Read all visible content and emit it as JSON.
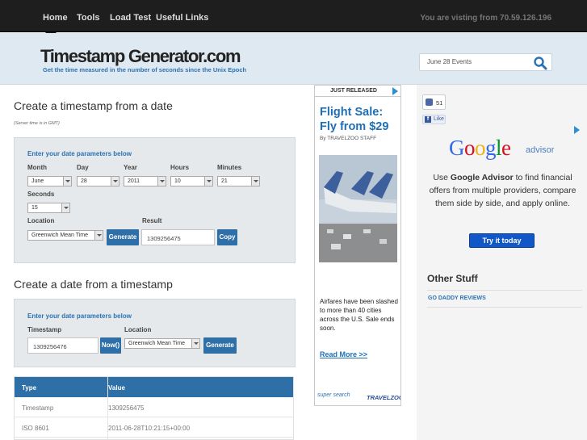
{
  "nav": {
    "items": [
      {
        "label": "Home"
      },
      {
        "label": "Tools"
      },
      {
        "label": "Load Test"
      },
      {
        "label": "Useful Links"
      }
    ],
    "visitor_text": "You are visting from 70.59.126.196"
  },
  "header": {
    "logo": "Timestamp Generator.com",
    "tagline": "Get the time measured in the number of seconds since the Unix Epoch",
    "search_value": "June 28 Events",
    "search_icon": "magnifier-icon"
  },
  "date_to_ts": {
    "title": "Create a timestamp from a date",
    "note": "(Server time is in GMT)",
    "panel_title": "Enter your date parameters below",
    "labels": {
      "month": "Month",
      "day": "Day",
      "year": "Year",
      "hours": "Hours",
      "minutes": "Minutes",
      "seconds": "Seconds",
      "location": "Location",
      "result": "Result"
    },
    "values": {
      "month": "June",
      "day": "28",
      "year": "2011",
      "hours": "10",
      "minutes": "21",
      "seconds": "15",
      "location": "Greenwich Mean Time",
      "result": "1309256475"
    },
    "generate_label": "Generate",
    "copy_label": "Copy"
  },
  "ts_to_date": {
    "title": "Create a date from a timestamp",
    "panel_title": "Enter your date parameters below",
    "labels": {
      "timestamp": "Timestamp",
      "location": "Location"
    },
    "values": {
      "timestamp": "1309256476",
      "location": "Greenwich Mean Time"
    },
    "now_label": "Now()",
    "generate_label": "Generate"
  },
  "results": {
    "headers": [
      "Type",
      "Value"
    ],
    "rows": [
      [
        "Timestamp",
        "1309256475"
      ],
      [
        "ISO 8601",
        "2011-06-28T10:21:15+00:00"
      ]
    ]
  },
  "ad_travel": {
    "badge": "JUST RELEASED",
    "headline": "Flight Sale: Fly from $29",
    "byline": "By TRAVELZOO STAFF",
    "body": "Airfares have been slashed to more than 40 cities across the U.S. Sale ends soon.",
    "read_more": "Read More >>",
    "logo_left": "super search",
    "logo_right": "TRAVELZOO",
    "image": "airplanes-photo"
  },
  "social": {
    "like_count": "51",
    "like_label": "Like"
  },
  "ad_google": {
    "logo_letters": [
      {
        "ch": "G",
        "color": "#3369e8"
      },
      {
        "ch": "o",
        "color": "#d50f25"
      },
      {
        "ch": "o",
        "color": "#eeb211"
      },
      {
        "ch": "g",
        "color": "#3369e8"
      },
      {
        "ch": "l",
        "color": "#009925"
      },
      {
        "ch": "e",
        "color": "#d50f25"
      }
    ],
    "product": "advisor",
    "body_prefix": "Use ",
    "body_bold": "Google Advisor",
    "body_suffix": " to find financial offers from multiple providers, compare them side by side, and apply online.",
    "button": "Try it today"
  },
  "other_stuff": {
    "title": "Other Stuff",
    "links": [
      "GO DADDY REVIEWS"
    ]
  }
}
